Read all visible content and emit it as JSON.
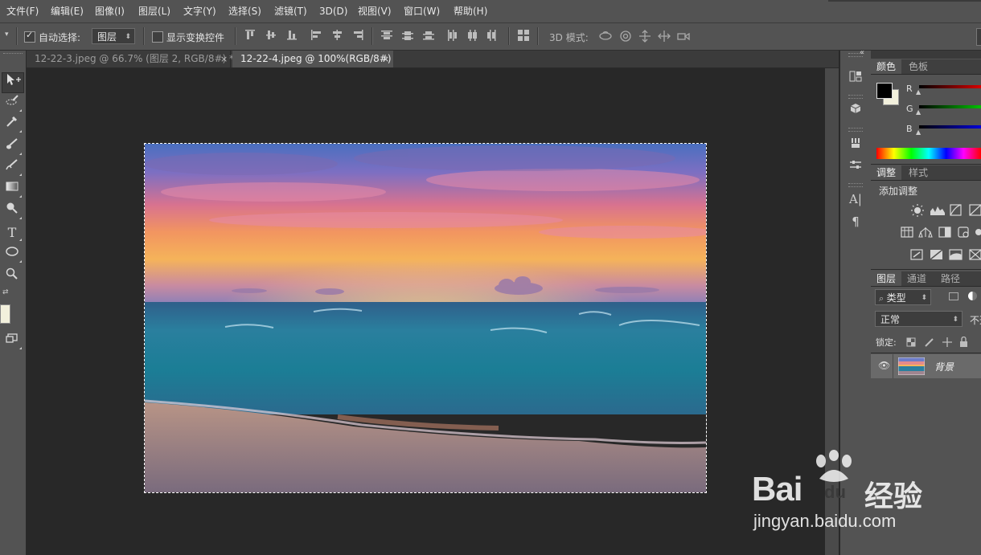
{
  "menu": [
    "文件(F)",
    "编辑(E)",
    "图像(I)",
    "图层(L)",
    "文字(Y)",
    "选择(S)",
    "滤镜(T)",
    "3D(D)",
    "视图(V)",
    "窗口(W)",
    "帮助(H)"
  ],
  "options": {
    "auto_select_label": "自动选择:",
    "auto_select_checked": true,
    "auto_select_target": "图层",
    "show_transform_label": "显示变换控件",
    "show_transform_checked": false,
    "mode3d_label": "3D 模式:"
  },
  "documents": [
    {
      "title": "12-22-3.jpeg @ 66.7% (图层 2, RGB/8#) *",
      "active": false
    },
    {
      "title": "12-22-4.jpeg @ 100%(RGB/8#)",
      "active": true
    }
  ],
  "panels": {
    "collapse_icon": "«",
    "color": {
      "tabs": [
        "颜色",
        "色板"
      ],
      "channels": [
        "R",
        "G",
        "B"
      ],
      "foreground": "#000000",
      "background": "#f2f0dc"
    },
    "adjustments": {
      "tabs": [
        "调整",
        "样式"
      ],
      "heading": "添加调整"
    },
    "layers": {
      "tabs": [
        "图层",
        "通道",
        "路径"
      ],
      "filter_label": "类型",
      "blend_mode": "正常",
      "opacity_label": "不透",
      "lock_label": "锁定:",
      "layer_name": "背景"
    }
  },
  "toolbox": {
    "foreground": "#000000",
    "background": "#f2f0dc"
  },
  "watermark": {
    "brand_left": "Bai",
    "brand_right": "经验",
    "brand_mid": "du",
    "url": "jingyan.baidu.com"
  },
  "colors": {
    "ui_bg": "#535353",
    "canvas_bg": "#282828",
    "panel_dark": "#3f3f3f"
  }
}
